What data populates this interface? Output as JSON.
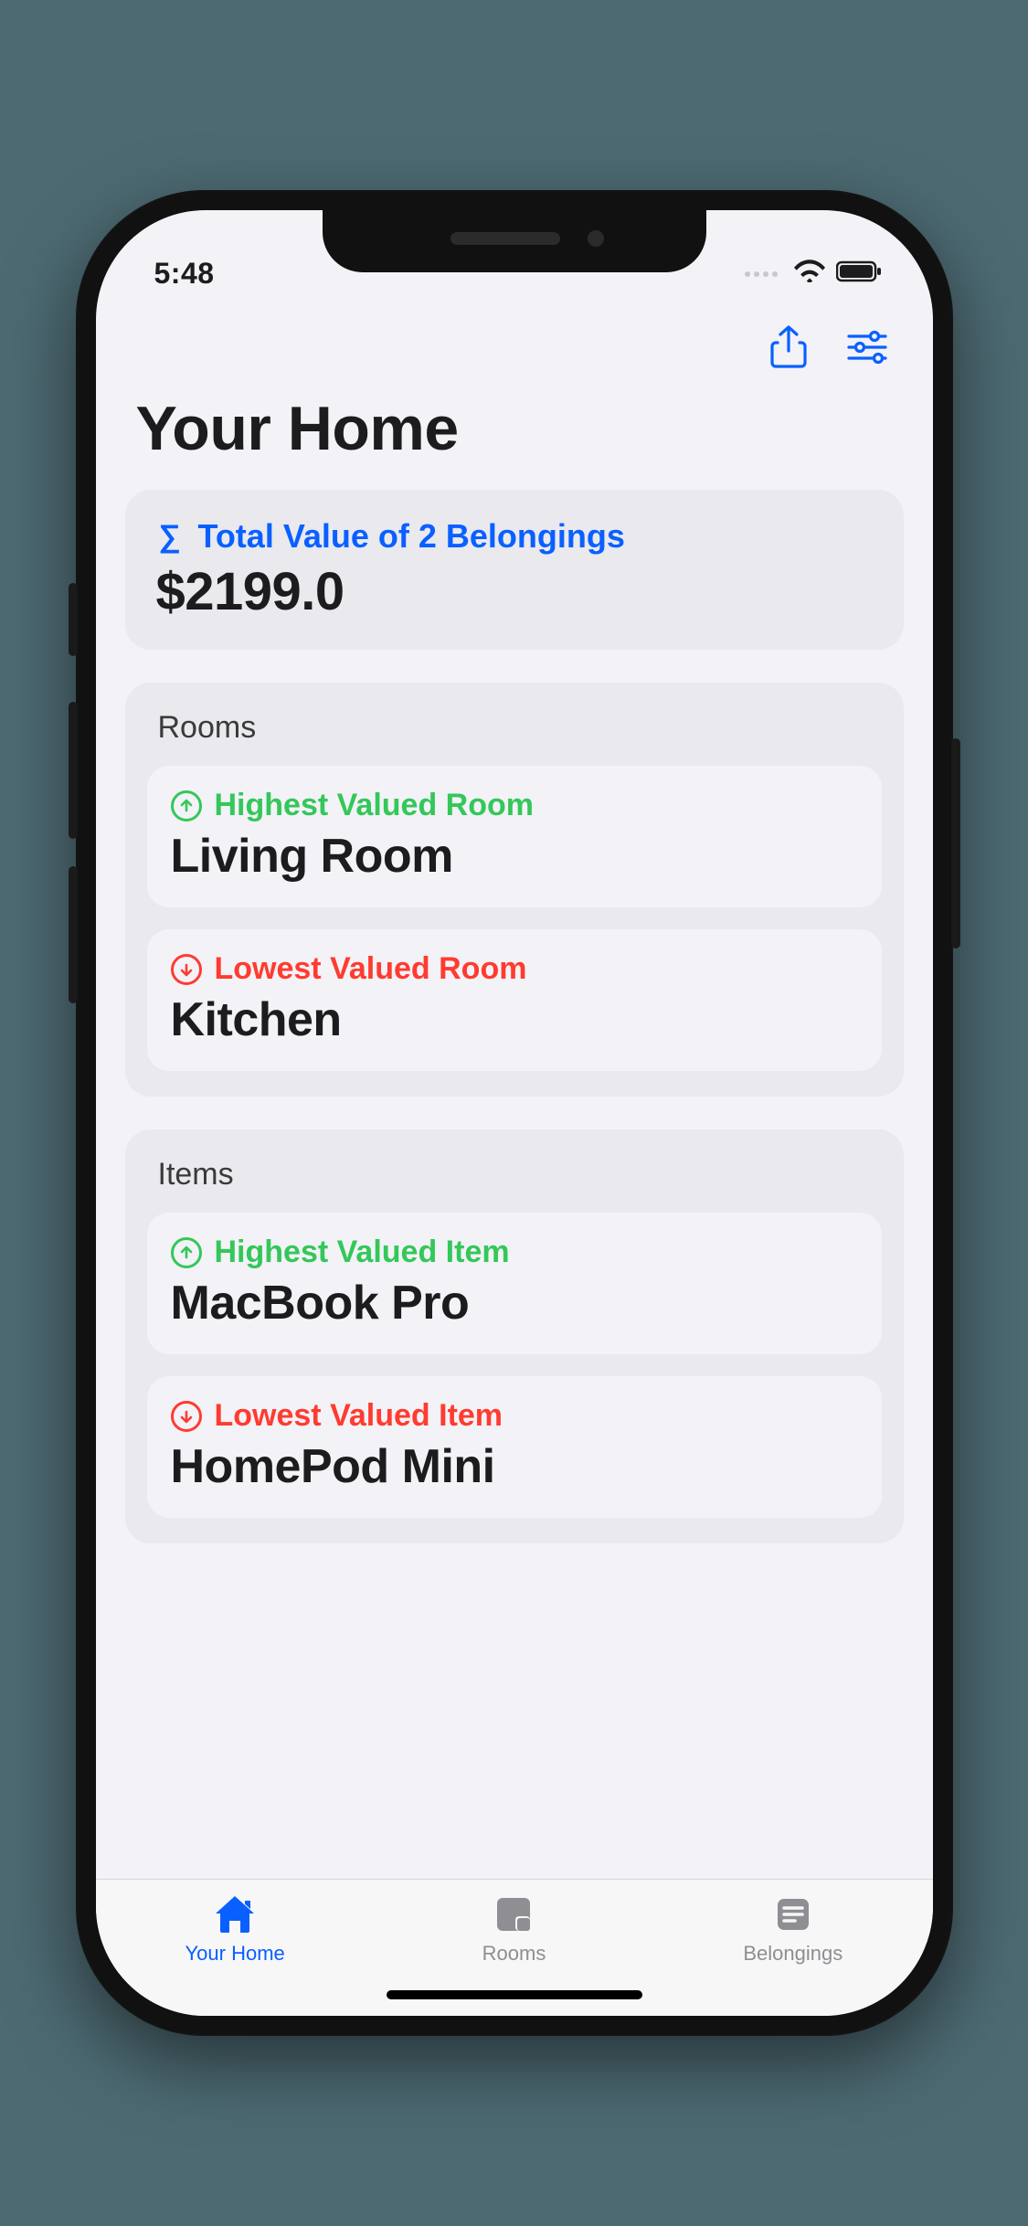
{
  "status": {
    "time": "5:48"
  },
  "header": {
    "title": "Your Home"
  },
  "total": {
    "label": "Total Value of 2 Belongings",
    "value": "$2199.0"
  },
  "rooms": {
    "header": "Rooms",
    "highest": {
      "label": "Highest Valued Room",
      "value": "Living Room"
    },
    "lowest": {
      "label": "Lowest Valued Room",
      "value": "Kitchen"
    }
  },
  "items": {
    "header": "Items",
    "highest": {
      "label": "Highest Valued Item",
      "value": "MacBook Pro"
    },
    "lowest": {
      "label": "Lowest Valued Item",
      "value": "HomePod Mini"
    }
  },
  "tabs": {
    "home": "Your Home",
    "rooms": "Rooms",
    "belongings": "Belongings"
  },
  "colors": {
    "accent": "#0a60ff",
    "green": "#34c759",
    "red": "#ff3b30"
  }
}
